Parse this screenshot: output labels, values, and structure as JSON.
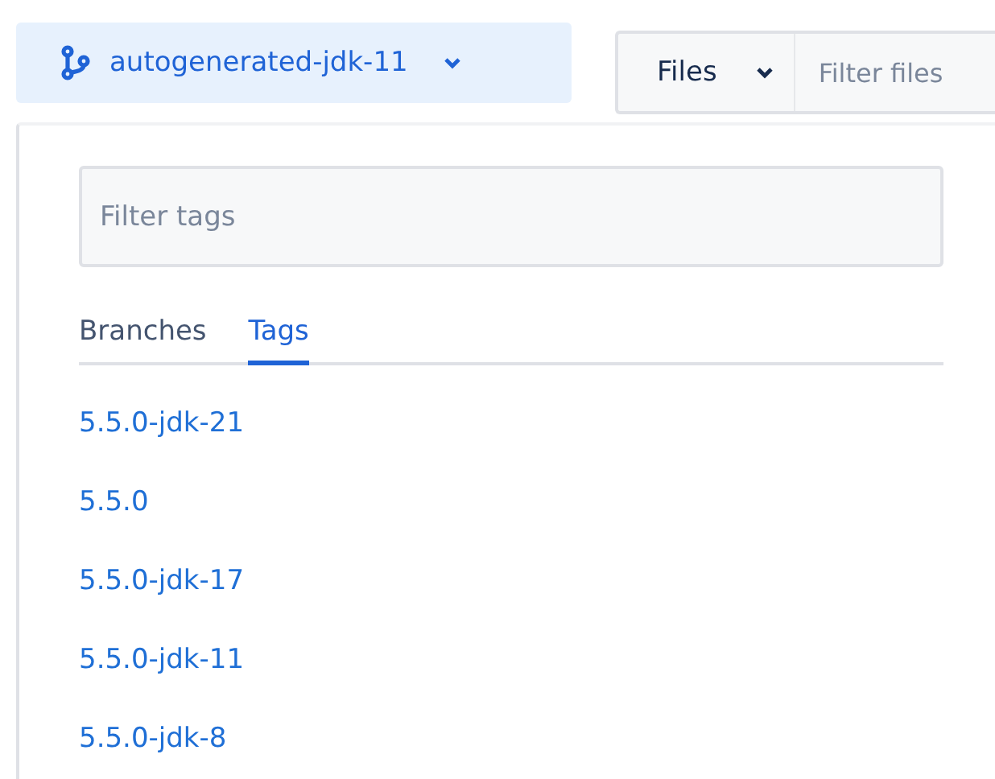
{
  "branch_selector": {
    "label": "autogenerated-jdk-11"
  },
  "files_bar": {
    "mode": "Files",
    "filter": {
      "placeholder": "Filter files"
    }
  },
  "dropdown": {
    "filter": {
      "placeholder": "Filter tags"
    },
    "tabs": [
      {
        "label": "Branches",
        "selected": false
      },
      {
        "label": "Tags",
        "selected": true
      }
    ],
    "items": [
      "5.5.0-jdk-21",
      "5.5.0",
      "5.5.0-jdk-17",
      "5.5.0-jdk-11",
      "5.5.0-jdk-8"
    ]
  }
}
